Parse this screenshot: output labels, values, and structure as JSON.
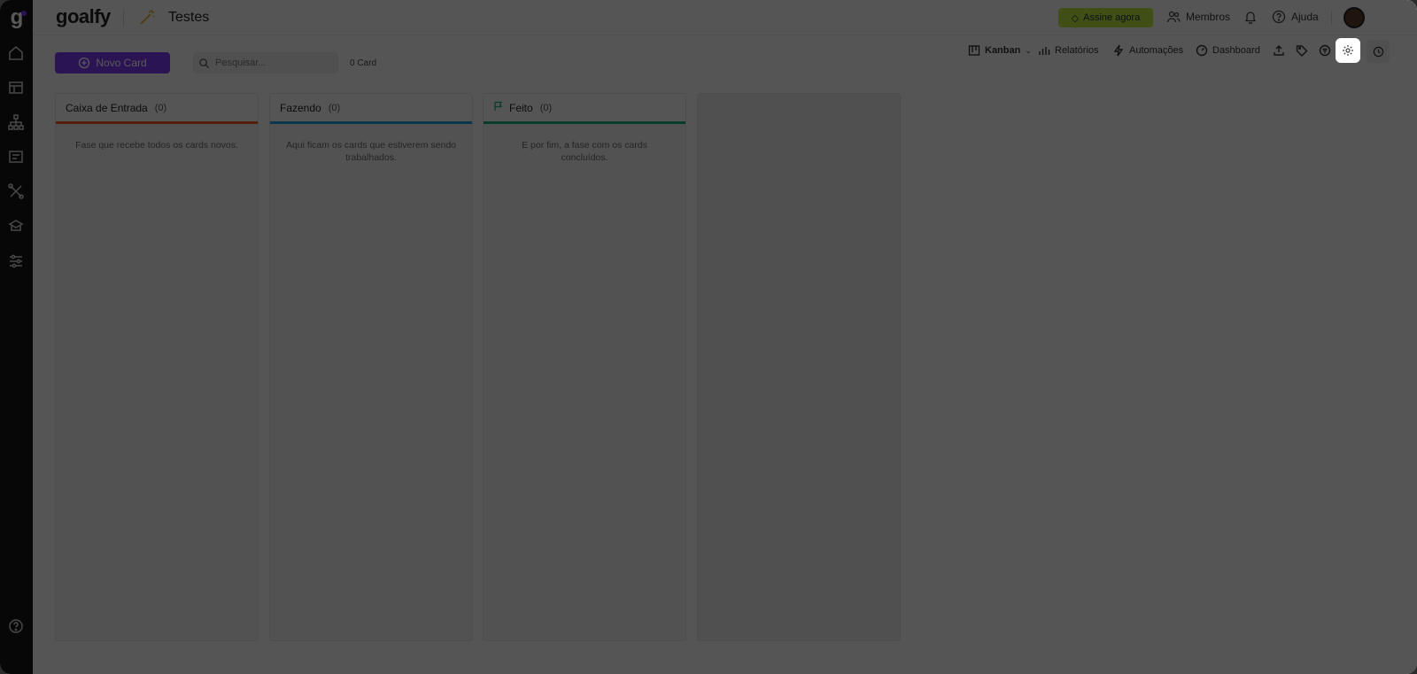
{
  "header": {
    "brand": "goalfy",
    "board_title": "Testes",
    "subscribe_label": "Assine agora",
    "members_label": "Membros",
    "help_label": "Ajuda"
  },
  "toolbar": {
    "view_label": "Kanban",
    "reports_label": "Relatórios",
    "automations_label": "Automações",
    "dashboard_label": "Dashboard"
  },
  "actions": {
    "new_card_label": "Novo Card",
    "search_placeholder": "Pesquisar...",
    "card_count": "0 Card"
  },
  "columns": [
    {
      "title": "Caixa de Entrada",
      "count": "(0)",
      "description": "Fase que recebe todos os cards novos.",
      "color": "#e8591a"
    },
    {
      "title": "Fazendo",
      "count": "(0)",
      "description": "Aqui ficam os cards que estiverem sendo trabalhados.",
      "color": "#1d9bd1"
    },
    {
      "title": "Feito",
      "count": "(0)",
      "description": "E por fim, a fase com os cards concluídos.",
      "color": "#1ab07a"
    }
  ],
  "colors": {
    "accent": "#7c3aed",
    "subscribe": "#b7e23c",
    "sidebar": "#141414"
  }
}
